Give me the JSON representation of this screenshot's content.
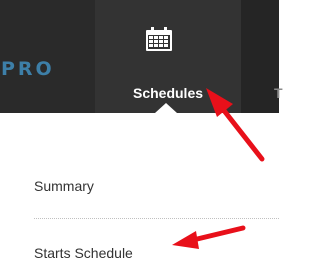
{
  "navbar": {
    "brand_text": "PRO",
    "active_item": {
      "label": "Schedules",
      "icon": "calendar-icon"
    },
    "next_item_partial_label": "T"
  },
  "submenu": {
    "items": [
      {
        "label": "Summary"
      },
      {
        "label": "Starts Schedule"
      }
    ]
  },
  "annotations": {
    "arrow_color": "#e8101a"
  },
  "colors": {
    "navbar_bg": "#252525",
    "active_tab_bg": "#333333",
    "brand_blue": "#3d7fa8",
    "text_dark": "#333333"
  }
}
